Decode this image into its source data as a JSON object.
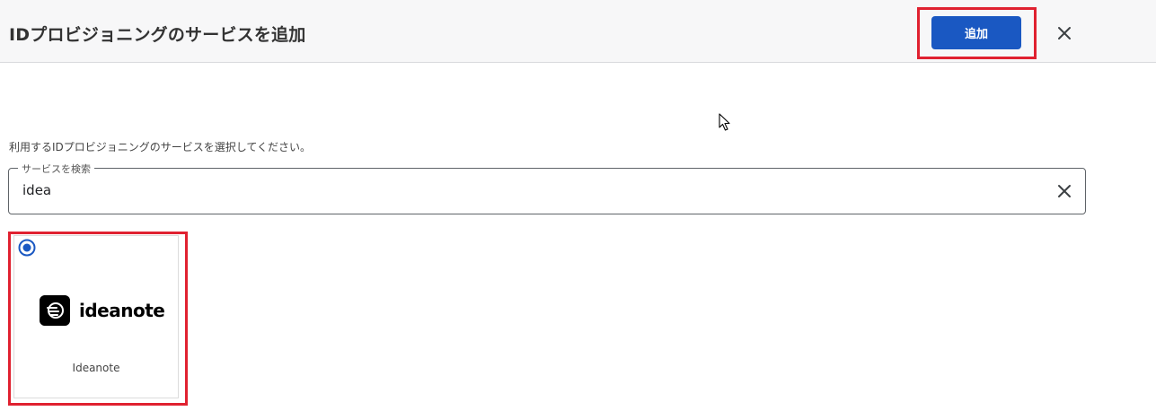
{
  "header": {
    "title": "IDプロビジョニングのサービスを追加",
    "add_button_label": "追加",
    "close_icon": "close-icon"
  },
  "instruction": "利用するIDプロビジョニングのサービスを選択してください。",
  "search": {
    "label": "サービスを検索",
    "value": "idea",
    "clear_icon": "close-icon"
  },
  "results": [
    {
      "logo_text": "ideanote",
      "logo_icon": "ideanote-logo-icon",
      "name": "Ideanote",
      "selected": true
    }
  ],
  "colors": {
    "accent": "#1a58c2",
    "highlight": "#e02130",
    "header_bg": "#f7f7f8"
  }
}
